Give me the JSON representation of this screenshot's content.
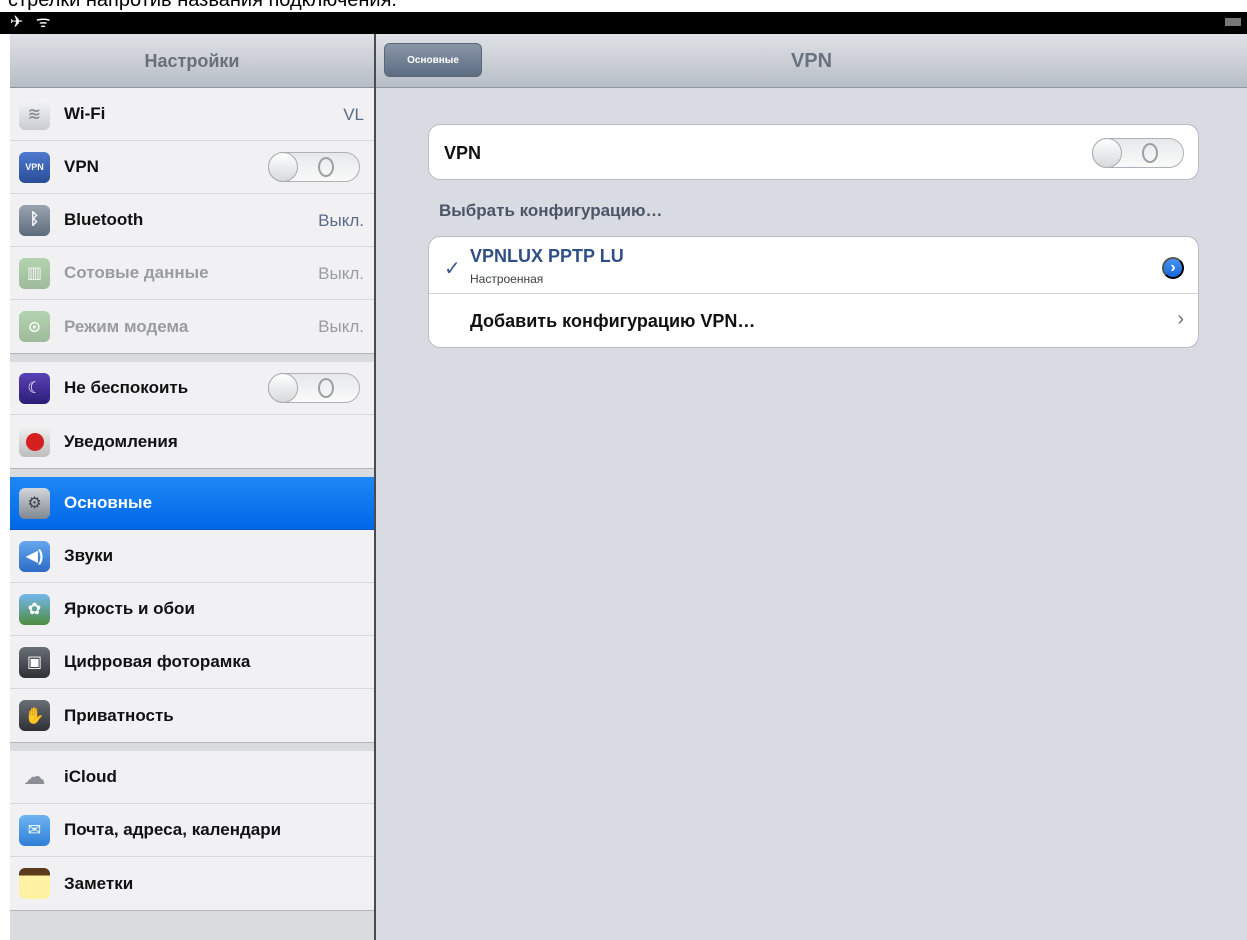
{
  "caption": "стрелки напротив названия подключения.",
  "status_bar": {
    "left_icons": "✈ ᯤ"
  },
  "sidebar": {
    "title": "Настройки",
    "groups": [
      {
        "items": [
          {
            "label": "Wi-Fi",
            "value": "VL",
            "icon": "wifi-icon"
          },
          {
            "label": "VPN",
            "toggle": "off",
            "icon": "vpn-icon"
          },
          {
            "label": "Bluetooth",
            "value": "Выкл.",
            "icon": "bluetooth-icon"
          },
          {
            "label": "Сотовые данные",
            "value": "Выкл.",
            "icon": "cellular-icon"
          },
          {
            "label": "Режим модема",
            "value": "Выкл.",
            "icon": "hotspot-icon"
          }
        ]
      },
      {
        "items": [
          {
            "label": "Не беспокоить",
            "toggle": "off",
            "icon": "moon-icon"
          },
          {
            "label": "Уведомления",
            "icon": "notifications-icon"
          }
        ]
      },
      {
        "items": [
          {
            "label": "Основные",
            "selected": true,
            "icon": "gear-icon"
          },
          {
            "label": "Звуки",
            "icon": "speaker-icon"
          },
          {
            "label": "Яркость и обои",
            "icon": "brightness-icon"
          },
          {
            "label": "Цифровая фоторамка",
            "icon": "photo-frame-icon"
          },
          {
            "label": "Приватность",
            "icon": "hand-icon"
          }
        ]
      },
      {
        "items": [
          {
            "label": "iCloud",
            "icon": "cloud-icon"
          },
          {
            "label": "Почта, адреса, календари",
            "icon": "mail-icon"
          },
          {
            "label": "Заметки",
            "icon": "notes-icon"
          }
        ]
      }
    ]
  },
  "navbar": {
    "back_label": "Основные",
    "title": "VPN"
  },
  "vpn_card": {
    "label": "VPN",
    "toggle": "off"
  },
  "config_section": {
    "header": "Выбрать конфигурацию…",
    "selected_config": {
      "name": "VPNLUX PPTP LU",
      "subtitle": "Настроенная"
    },
    "add_label": "Добавить конфигурацию VPN…"
  },
  "colors": {
    "selected_blue": "#0b77f0",
    "detail_blue": "#1f73e5",
    "config_name_blue": "#2f4f86"
  }
}
